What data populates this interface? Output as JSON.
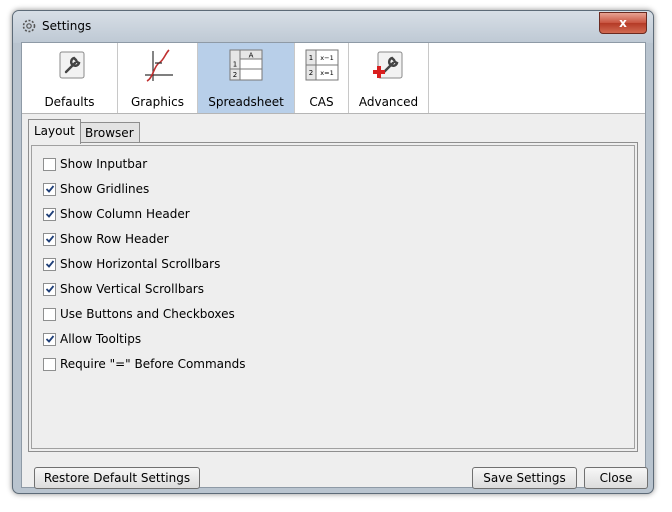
{
  "window": {
    "title": "Settings",
    "close_label": "x"
  },
  "toolbar": {
    "items": [
      {
        "label": "Defaults",
        "icon": "wrench-icon",
        "selected": false
      },
      {
        "label": "Graphics",
        "icon": "graphics-icon",
        "selected": false
      },
      {
        "label": "Spreadsheet",
        "icon": "spreadsheet-icon",
        "selected": true
      },
      {
        "label": "CAS",
        "icon": "cas-icon",
        "selected": false
      },
      {
        "label": "Advanced",
        "icon": "advanced-icon",
        "selected": false
      }
    ],
    "spreadsheet_icon": {
      "col": "A",
      "row1": "1",
      "row2": "2"
    },
    "cas_icon": {
      "row1": "1",
      "row2": "2",
      "expr1": "x−1",
      "expr2": "x=1"
    }
  },
  "tabs": [
    {
      "label": "Layout",
      "active": true
    },
    {
      "label": "Browser",
      "active": false
    }
  ],
  "options": [
    {
      "label": "Show Inputbar",
      "checked": false
    },
    {
      "label": "Show Gridlines",
      "checked": true
    },
    {
      "label": "Show Column Header",
      "checked": true
    },
    {
      "label": "Show Row Header",
      "checked": true
    },
    {
      "label": "Show Horizontal Scrollbars",
      "checked": true
    },
    {
      "label": "Show Vertical Scrollbars",
      "checked": true
    },
    {
      "label": "Use Buttons and Checkboxes",
      "checked": false
    },
    {
      "label": "Allow Tooltips",
      "checked": true
    },
    {
      "label": "Require \"=\" Before Commands",
      "checked": false
    }
  ],
  "buttons": {
    "restore": "Restore Default Settings",
    "save": "Save Settings",
    "close": "Close"
  },
  "colors": {
    "selected_tool": "#b8cfe9",
    "check": "#1f3f78",
    "close_button": "#c8533f"
  }
}
